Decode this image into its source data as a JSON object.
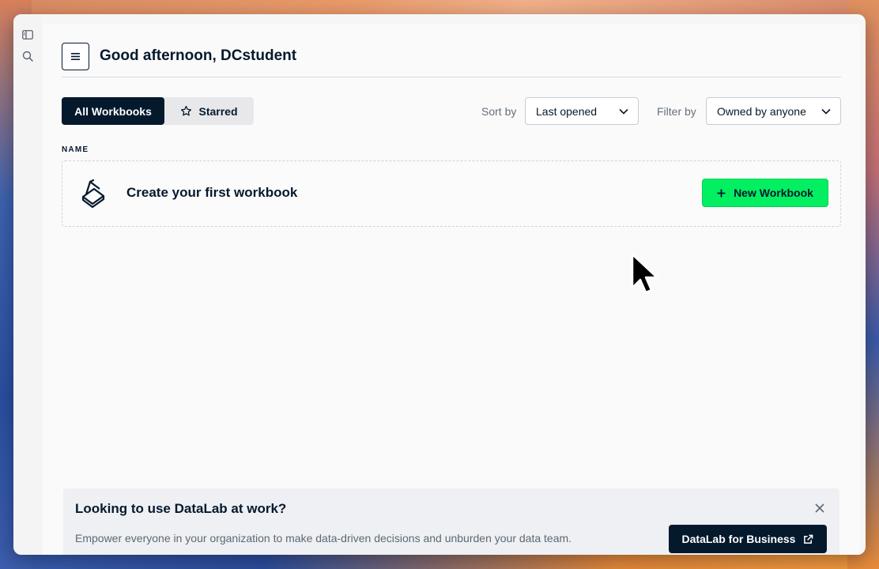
{
  "header": {
    "greeting": "Good afternoon, DCstudent",
    "menu_icon": "menu-icon"
  },
  "sidebar": {
    "icons": [
      "sidebar-toggle-icon",
      "search-icon"
    ]
  },
  "tabs": [
    {
      "label": "All Workbooks",
      "active": true
    },
    {
      "label": "Starred",
      "active": false,
      "icon": "star-icon"
    }
  ],
  "sort": {
    "label": "Sort by",
    "value": "Last opened"
  },
  "filter": {
    "label": "Filter by",
    "value": "Owned by anyone"
  },
  "list": {
    "column_header": "NAME",
    "empty_message": "Create your first workbook",
    "new_button_label": "New Workbook"
  },
  "banner": {
    "title": "Looking to use DataLab at work?",
    "text": "Empower everyone in your organization to make data-driven decisions and unburden your data team.",
    "button_label": "DataLab for Business"
  },
  "colors": {
    "brand_dark": "#05192d",
    "brand_green": "#03ef62"
  }
}
